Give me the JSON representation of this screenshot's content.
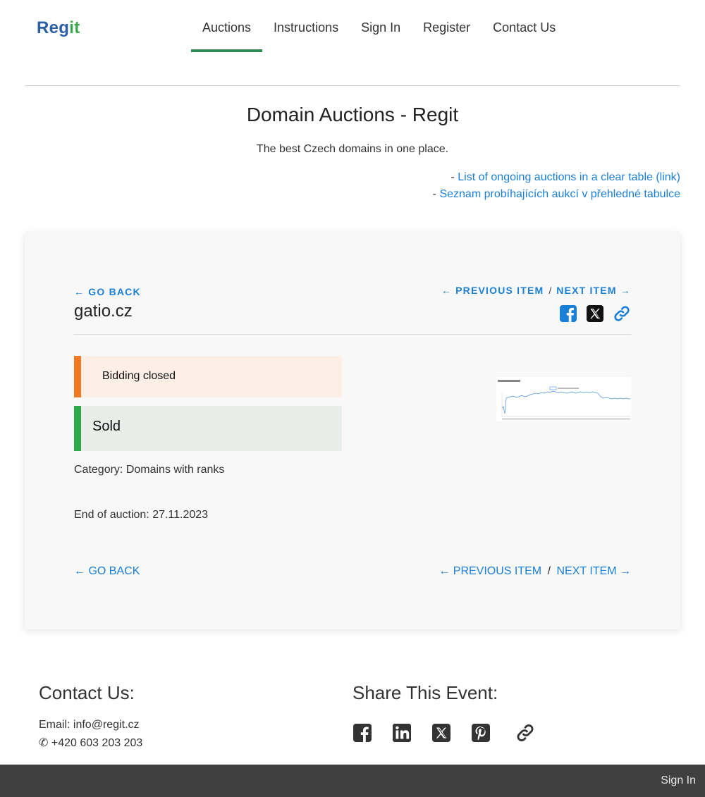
{
  "header": {
    "logo": {
      "part1": "Reg",
      "part2": "it"
    },
    "nav": [
      {
        "label": "Auctions",
        "active": true
      },
      {
        "label": "Instructions"
      },
      {
        "label": "Sign In"
      },
      {
        "label": "Register"
      },
      {
        "label": "Contact Us"
      }
    ]
  },
  "intro": {
    "title": "Domain Auctions - Regit",
    "subtitle": "The best Czech domains in one place.",
    "link1_prefix": "- ",
    "link1": "List of ongoing auctions in a clear table (link)",
    "link2_prefix": "- ",
    "link2": "Seznam probíhajících aukcí v přehledné tabulce"
  },
  "item": {
    "go_back": "GO BACK",
    "previous": "PREVIOUS ITEM",
    "next": "NEXT ITEM",
    "separator": "/",
    "domain": "gatio.cz",
    "status_closed": "Bidding closed",
    "status_sold": "Sold",
    "category": "Category: Domains with ranks",
    "end": "End of auction: 27.11.2023",
    "go_back_bottom": "GO BACK",
    "previous_bottom": "PREVIOUS ITEM",
    "next_bottom": "NEXT ITEM",
    "share_icons": [
      "facebook-icon",
      "x-icon",
      "link-icon"
    ]
  },
  "footer": {
    "contact_title": "Contact Us:",
    "email": "Email: info@regit.cz",
    "phone": "+420 603 203 203",
    "share_title": "Share This Event:",
    "share_icons": [
      "facebook-icon",
      "linkedin-icon",
      "x-icon",
      "pinterest-icon",
      "link-icon"
    ],
    "signin": "Sign In"
  },
  "colors": {
    "link": "#1a7fd6",
    "nav_active": "#2e8b57",
    "closed_accent": "#f07a23",
    "sold_accent": "#2ea84a",
    "footer_bar": "#404040"
  }
}
